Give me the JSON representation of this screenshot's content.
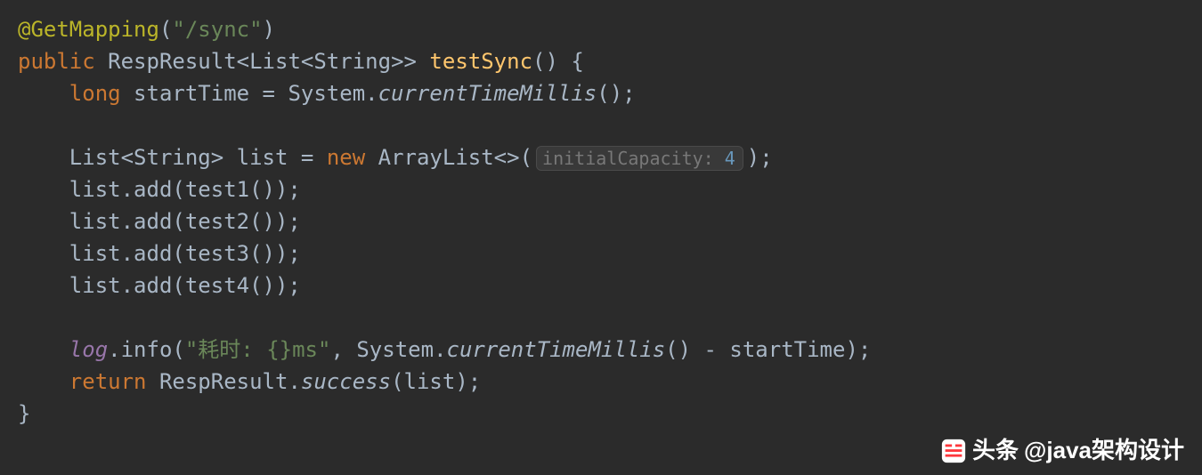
{
  "code": {
    "annotation": "@GetMapping",
    "annotation_arg": "\"/sync\"",
    "kw_public": "public",
    "ret_type1": "RespResult",
    "ret_type2": "List",
    "ret_type3": "String",
    "method_name": "testSync",
    "kw_long": "long",
    "var_start": "startTime",
    "sys": "System",
    "ctm": "currentTimeMillis",
    "list_type": "List",
    "list_generic": "String",
    "var_list": "list",
    "kw_new": "new",
    "arraylist": "ArrayList",
    "hint_label": "initialCapacity:",
    "hint_value": "4",
    "add1": "list.add(test1());",
    "add2": "list.add(test2());",
    "add3": "list.add(test3());",
    "add4": "list.add(test4());",
    "log_field": "log",
    "log_method": "info",
    "log_string": "\"耗时: {}ms\"",
    "kw_return": "return",
    "resp_result": "RespResult",
    "success": "success",
    "list_arg": "list"
  },
  "watermark": {
    "prefix": "头条",
    "text": "@java架构设计"
  }
}
